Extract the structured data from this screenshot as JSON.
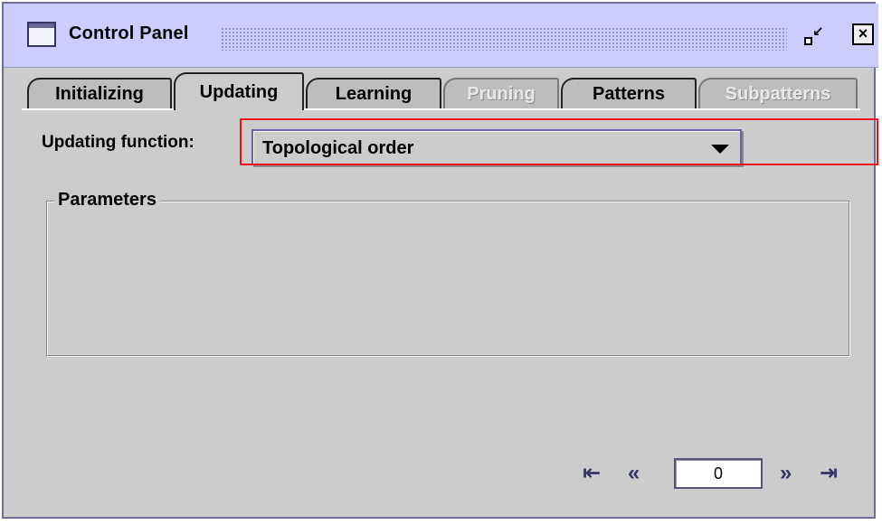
{
  "window": {
    "title": "Control Panel",
    "icons": {
      "app": "window-icon",
      "restore": "restore-icon",
      "close": "close-icon"
    }
  },
  "tabs": [
    {
      "label": "Initializing",
      "selected": false,
      "enabled": true
    },
    {
      "label": "Updating",
      "selected": true,
      "enabled": true
    },
    {
      "label": "Learning",
      "selected": false,
      "enabled": true
    },
    {
      "label": "Pruning",
      "selected": false,
      "enabled": false
    },
    {
      "label": "Patterns",
      "selected": false,
      "enabled": true
    },
    {
      "label": "Subpatterns",
      "selected": false,
      "enabled": false
    }
  ],
  "updating": {
    "function_label": "Updating function:",
    "function_value": "Topological order",
    "parameters_label": "Parameters"
  },
  "navigation": {
    "first": "first-icon",
    "prev": "prev-icon",
    "page_value": "0",
    "next": "next-icon",
    "last": "last-icon"
  },
  "colors": {
    "titlebar": "#ccccff",
    "panel": "#cccccc",
    "highlight": "#e8141c",
    "border": "#6f6f99"
  }
}
